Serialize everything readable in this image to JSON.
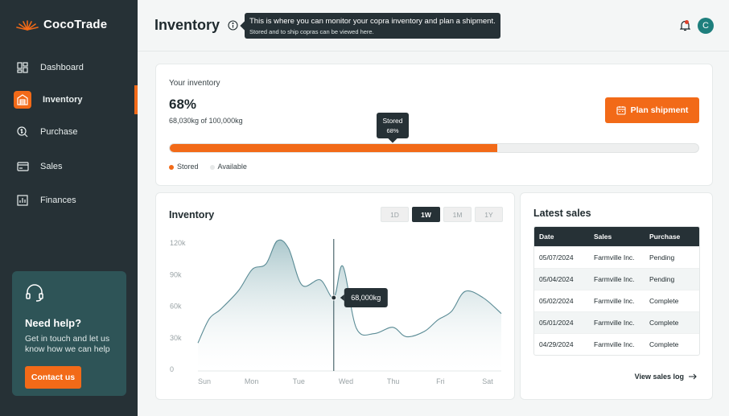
{
  "app": {
    "name": "CocoTrade"
  },
  "sidebar": {
    "items": [
      {
        "label": "Dashboard",
        "icon": "dashboard-icon"
      },
      {
        "label": "Inventory",
        "icon": "warehouse-icon",
        "active": true
      },
      {
        "label": "Purchase",
        "icon": "purchase-icon"
      },
      {
        "label": "Sales",
        "icon": "sales-icon"
      },
      {
        "label": "Finances",
        "icon": "finances-icon"
      }
    ],
    "help": {
      "title": "Need help?",
      "text": "Get in touch and let us know how we can help",
      "button": "Contact us"
    }
  },
  "header": {
    "title": "Inventory",
    "tooltip_line1": "This is where you can monitor your copra inventory and plan a shipment.",
    "tooltip_line2": "Stored and to ship copras can be viewed here.",
    "avatar_initial": "C"
  },
  "inventory_card": {
    "label": "Your inventory",
    "percent": "68%",
    "stored_fraction": 0.62,
    "sub": "68,030kg of 100,000kg",
    "plan_button": "Plan shipment",
    "tooltip_title": "Stored",
    "tooltip_value": "68%",
    "legend_stored": "Stored",
    "legend_available": "Available",
    "colors": {
      "stored": "#f26a18",
      "available": "#eeefef"
    }
  },
  "chart_card": {
    "title": "Inventory",
    "ranges": [
      "1D",
      "1W",
      "1M",
      "1Y"
    ],
    "active_range": "1W",
    "hover_label": "68,000kg"
  },
  "chart_data": {
    "type": "area",
    "x_labels": [
      "Sun",
      "Mon",
      "Tue",
      "Wed",
      "Thu",
      "Fri",
      "Sat"
    ],
    "y_ticks": [
      "0",
      "30k",
      "60k",
      "90k",
      "120k"
    ],
    "ylim": [
      0,
      120000
    ],
    "x": [
      0,
      0.25,
      0.5,
      0.9,
      1.2,
      1.5,
      1.75,
      2.0,
      2.3,
      2.7,
      3.0,
      3.2,
      3.5,
      3.9,
      4.3,
      4.6,
      5.0,
      5.3,
      5.6,
      5.9,
      6.3,
      6.7
    ],
    "values": [
      25000,
      48000,
      57000,
      75000,
      95000,
      100000,
      122000,
      115000,
      80000,
      85000,
      68000,
      98000,
      39000,
      34000,
      40000,
      31000,
      36000,
      47000,
      55000,
      74000,
      68000,
      53000
    ],
    "hover_x": 3.0,
    "hover_value": 68000,
    "grid": false,
    "color": "#5a8b95"
  },
  "sales_card": {
    "title": "Latest sales",
    "columns": [
      "Date",
      "Sales",
      "Purchase"
    ],
    "rows": [
      [
        "05/07/2024",
        "Farmville Inc.",
        "Pending"
      ],
      [
        "05/04/2024",
        "Farmville Inc.",
        "Pending"
      ],
      [
        "05/02/2024",
        "Farmville Inc.",
        "Complete"
      ],
      [
        "05/01/2024",
        "Farmville Inc.",
        "Complete"
      ],
      [
        "04/29/2024",
        "Farmville Inc.",
        "Complete"
      ]
    ],
    "link": "View sales log"
  }
}
